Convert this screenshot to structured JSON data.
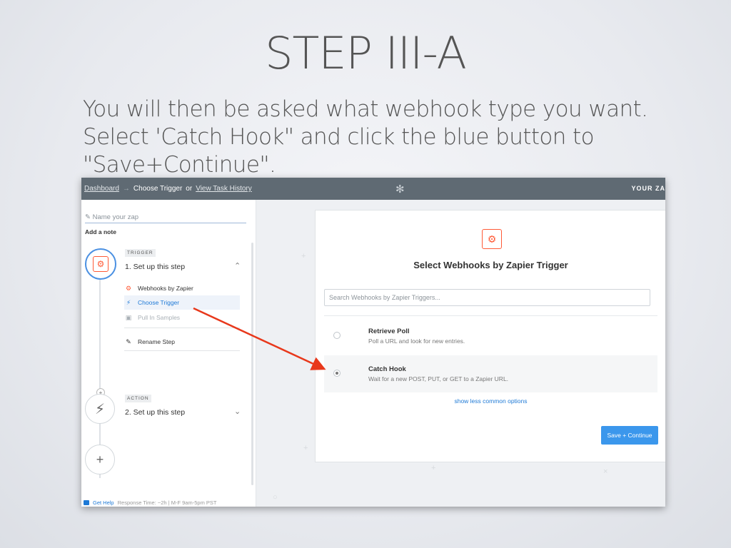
{
  "slide": {
    "title": "STEP III-A",
    "body": "You will then be asked what webhook type you want. Select 'Catch Hook\" and click the blue button to \"Save+Continue\"."
  },
  "topbar": {
    "crumb_dashboard": "Dashboard",
    "arrow": "→",
    "crumb_current": "Choose Trigger",
    "or": "or",
    "crumb_history": "View Task History",
    "right_text": "YOUR ZA"
  },
  "sidebar": {
    "zap_name_placeholder": "Name your zap",
    "add_note": "Add a note",
    "trigger": {
      "badge": "TRIGGER",
      "title": "1. Set up this step",
      "items": [
        {
          "label": "Webhooks by Zapier",
          "icon": "webhook-icon"
        },
        {
          "label": "Choose Trigger",
          "icon": "bolt-icon"
        },
        {
          "label": "Pull In Samples",
          "icon": "lock-icon"
        }
      ],
      "rename": "Rename Step"
    },
    "action": {
      "badge": "ACTION",
      "title": "2. Set up this step"
    },
    "help": {
      "label": "Get Help",
      "info": "Response Time: ~2h | M-F 9am-5pm PST"
    }
  },
  "card": {
    "title": "Select Webhooks by Zapier Trigger",
    "search_placeholder": "Search Webhooks by Zapier Triggers...",
    "options": [
      {
        "title": "Retrieve Poll",
        "desc": "Poll a URL and look for new entries.",
        "selected": false
      },
      {
        "title": "Catch Hook",
        "desc": "Wait for a new POST, PUT, or GET to a Zapier URL.",
        "selected": true
      }
    ],
    "show_less": "show less common options",
    "save_button": "Save + Continue"
  },
  "colors": {
    "accent_blue": "#3b97ec",
    "webhook_orange": "#ff5a36",
    "annotation_red": "#e8381b",
    "topbar": "#5f6a73"
  }
}
